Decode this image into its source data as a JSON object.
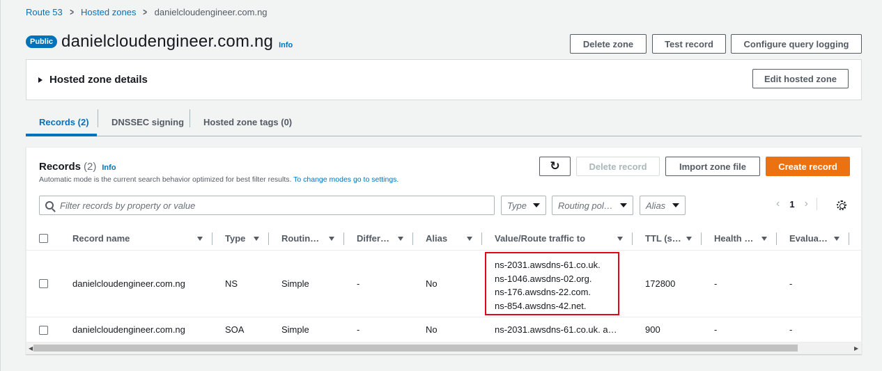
{
  "breadcrumb": {
    "items": [
      "Route 53",
      "Hosted zones"
    ],
    "current": "danielcloudengineer.com.ng"
  },
  "header": {
    "badge": "Public",
    "title": "danielcloudengineer.com.ng",
    "info": "Info",
    "buttons": {
      "delete_zone": "Delete zone",
      "test_record": "Test record",
      "configure_logging": "Configure query logging"
    }
  },
  "details": {
    "title": "Hosted zone details",
    "edit_button": "Edit hosted zone"
  },
  "tabs": [
    {
      "label": "Records (2)",
      "active": true
    },
    {
      "label": "DNSSEC signing",
      "active": false
    },
    {
      "label": "Hosted zone tags (0)",
      "active": false
    }
  ],
  "records": {
    "title": "Records",
    "count": "(2)",
    "info": "Info",
    "description": "Automatic mode is the current search behavior optimized for best filter results.",
    "description_link": "To change modes go to settings.",
    "buttons": {
      "delete": "Delete record",
      "import": "Import zone file",
      "create": "Create record"
    },
    "filter_placeholder": "Filter records by property or value",
    "filters": [
      "Type",
      "Routing pol…",
      "Alias"
    ],
    "page": "1",
    "columns": [
      "Record name",
      "Type",
      "Routin…",
      "Differ…",
      "Alias",
      "Value/Route traffic to",
      "TTL (s…",
      "Health …",
      "Evalua…"
    ],
    "rows": [
      {
        "name": "danielcloudengineer.com.ng",
        "type": "NS",
        "routing": "Simple",
        "differ": "-",
        "alias": "No",
        "values": [
          "ns-2031.awsdns-61.co.uk.",
          "ns-1046.awsdns-02.org.",
          "ns-176.awsdns-22.com.",
          "ns-854.awsdns-42.net."
        ],
        "ttl": "172800",
        "health": "-",
        "evaluate": "-"
      },
      {
        "name": "danielcloudengineer.com.ng",
        "type": "SOA",
        "routing": "Simple",
        "differ": "-",
        "alias": "No",
        "value": "ns-2031.awsdns-61.co.uk. a…",
        "ttl": "900",
        "health": "-",
        "evaluate": "-"
      }
    ]
  },
  "colors": {
    "link": "#0073bb",
    "primary": "#ec7211",
    "highlight": "#e0061b"
  }
}
